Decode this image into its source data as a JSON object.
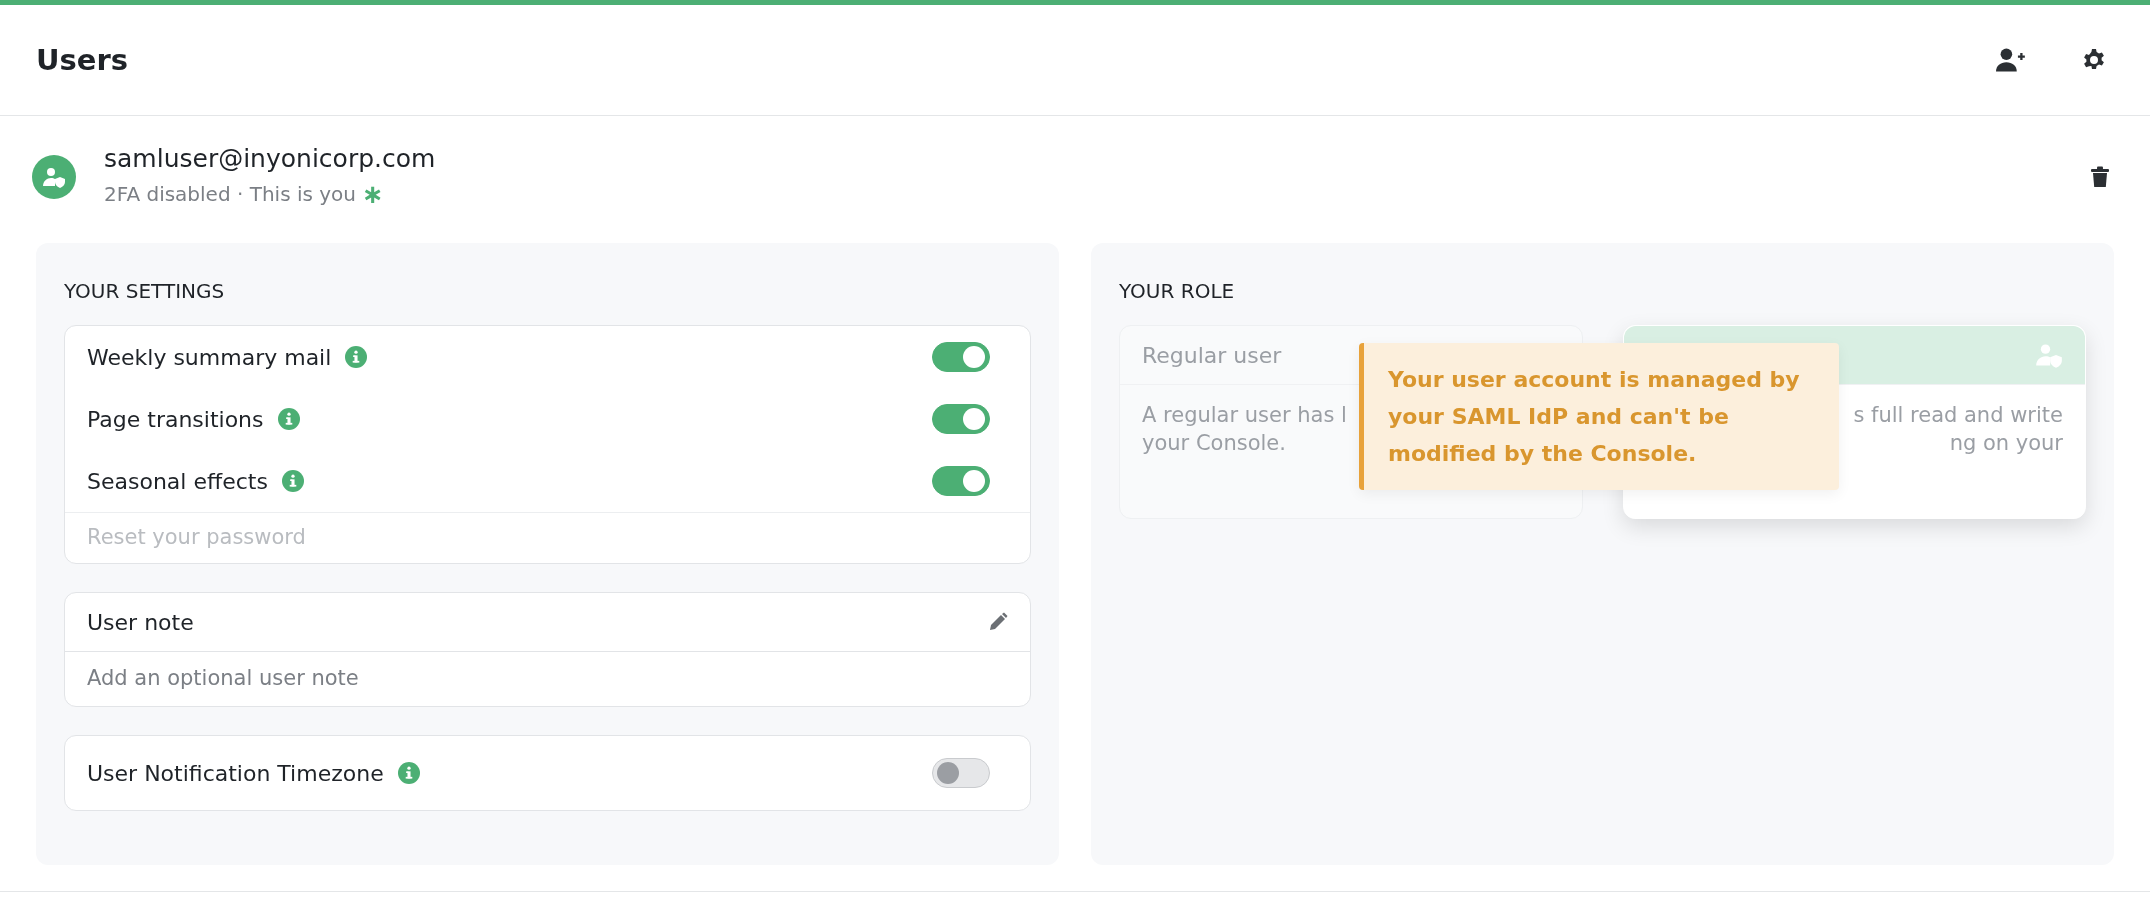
{
  "header": {
    "title": "Users"
  },
  "user": {
    "email": "samluser@inyonicorp.com",
    "status": "2FA disabled · This is you",
    "marker": "∗"
  },
  "settings": {
    "heading": "YOUR SETTINGS",
    "toggles": [
      {
        "label": "Weekly summary mail",
        "on": true
      },
      {
        "label": "Page transitions",
        "on": true
      },
      {
        "label": "Seasonal effects",
        "on": true
      }
    ],
    "reset_link": "Reset your password",
    "note": {
      "label": "User note",
      "placeholder": "Add an optional user note"
    },
    "timezone": {
      "label": "User Notification Timezone",
      "on": false
    }
  },
  "role": {
    "heading": "YOUR ROLE",
    "cards": [
      {
        "title": "Regular user",
        "selected": false,
        "lines": [
          "A regular user has l",
          "your Console."
        ]
      },
      {
        "selected": true,
        "lines": [
          "s full read and write",
          "ng on your"
        ]
      }
    ],
    "tooltip": "Your user account is managed by your SAML IdP and can't be modified by the Console."
  }
}
